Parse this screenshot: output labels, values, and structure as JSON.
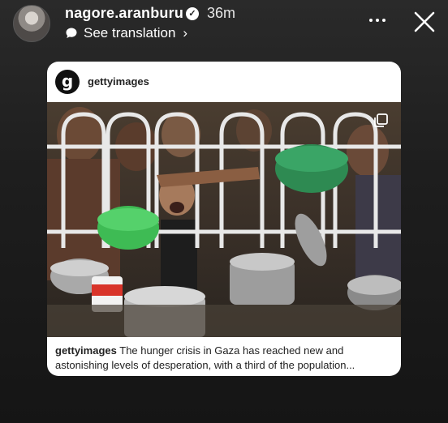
{
  "story_header": {
    "username": "nagore.aranburu",
    "verified_badge": "✓",
    "time_ago": "36m",
    "translation_label": "See translation",
    "chevron": "›"
  },
  "shared_post": {
    "account": "gettyimages",
    "logo_letter": "g",
    "caption_user": "gettyimages",
    "caption_text": " The hunger crisis in Gaza has reached new and astonishing levels of desperation, with a third of the population..."
  },
  "icons": {
    "more": "more-options-icon",
    "close": "close-icon",
    "translate": "speech-bubble-icon",
    "multi": "multiple-images-icon"
  },
  "colors": {
    "background": "#1e1e1e",
    "card": "#ffffff",
    "text_primary": "#ffffff"
  }
}
